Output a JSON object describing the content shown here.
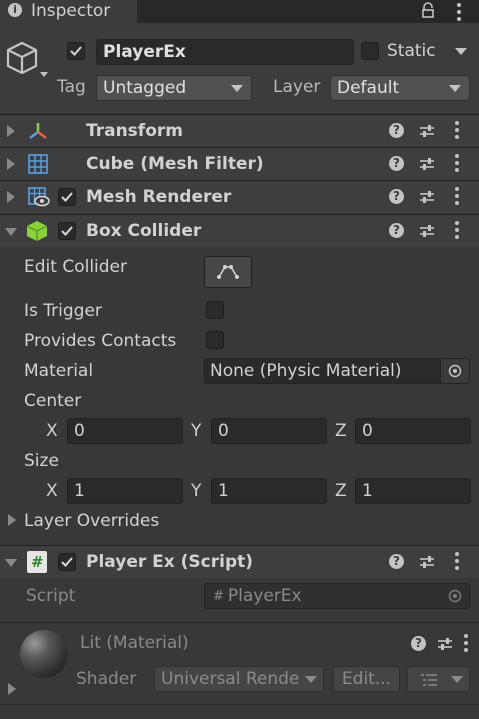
{
  "tab": {
    "title": "Inspector"
  },
  "object": {
    "name": "PlayerEx",
    "active": true,
    "static_label": "Static",
    "tag_label": "Tag",
    "tag_value": "Untagged",
    "layer_label": "Layer",
    "layer_value": "Default"
  },
  "components": {
    "transform": {
      "label": "Transform"
    },
    "mesh_filter": {
      "label": "Cube (Mesh Filter)"
    },
    "mesh_renderer": {
      "label": "Mesh Renderer"
    },
    "box_collider": {
      "label": "Box Collider"
    },
    "script": {
      "label": "Player Ex (Script)"
    }
  },
  "box_collider": {
    "edit_collider_label": "Edit Collider",
    "is_trigger_label": "Is Trigger",
    "provides_contacts_label": "Provides Contacts",
    "material_label": "Material",
    "material_value": "None (Physic Material)",
    "center_label": "Center",
    "center": {
      "x_label": "X",
      "y_label": "Y",
      "z_label": "Z",
      "x": "0",
      "y": "0",
      "z": "0"
    },
    "size_label": "Size",
    "size": {
      "x_label": "X",
      "y_label": "Y",
      "z_label": "Z",
      "x": "1",
      "y": "1",
      "z": "1"
    },
    "layer_overrides_label": "Layer Overrides"
  },
  "script_comp": {
    "script_label": "Script",
    "script_value": "PlayerEx"
  },
  "material": {
    "name": "Lit (Material)",
    "shader_label": "Shader",
    "shader_value": "Universal Rende",
    "edit_label": "Edit..."
  },
  "colors": {
    "background": "#383838",
    "header": "#3e3e3e",
    "field": "#2a2a2a",
    "text": "#d2d2d2",
    "collider_green": "#8ad13c",
    "script_green": "#79c94a"
  },
  "icons": [
    "info-icon",
    "lock-icon",
    "kebab-menu-icon",
    "cube-outline-icon",
    "transform-gizmo-icon",
    "grid-mesh-icon",
    "mesh-renderer-icon",
    "box-collider-icon",
    "script-hash-icon",
    "help-icon",
    "preset-sliders-icon",
    "edit-collider-icon",
    "object-picker-icon",
    "material-sphere-icon",
    "list-icon"
  ]
}
